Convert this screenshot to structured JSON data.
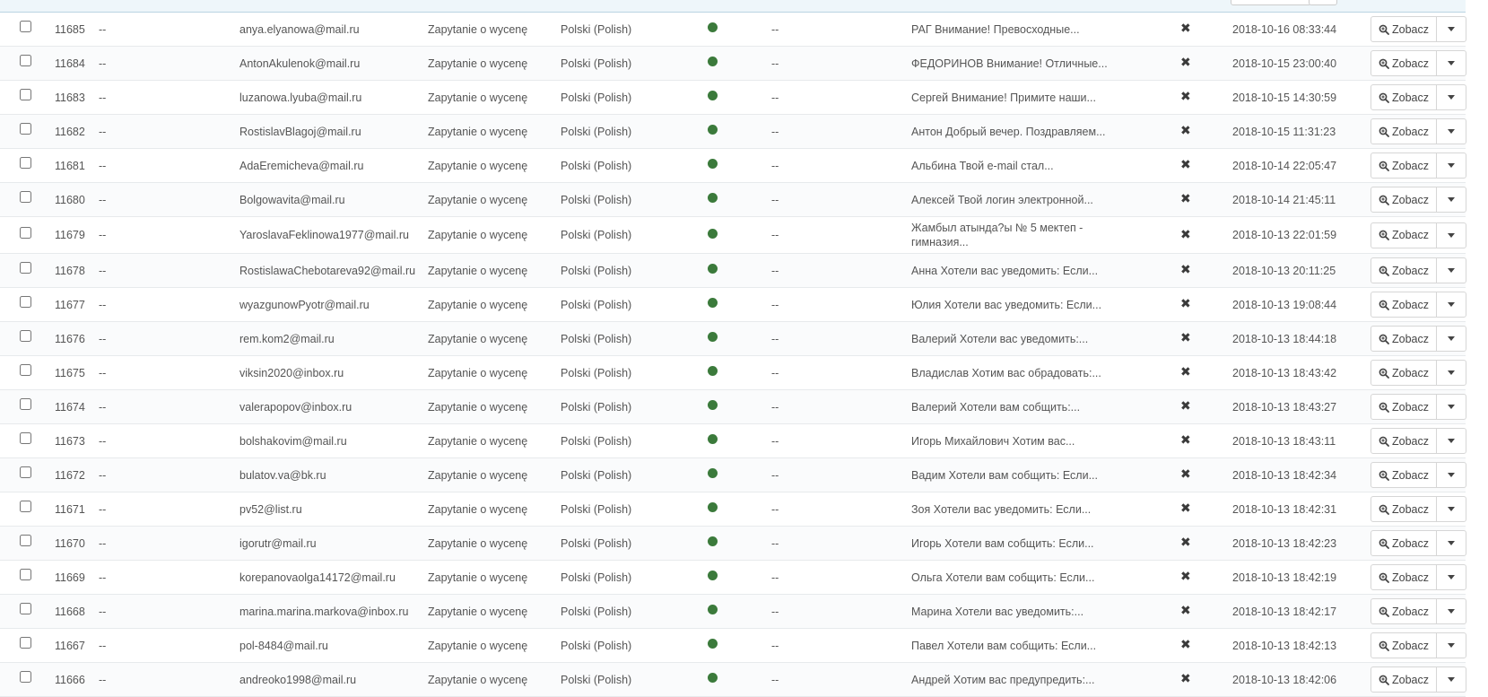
{
  "colors": {
    "status_active": "#3b7a3b",
    "header_band": "#eef6fa"
  },
  "icons": {
    "status": "filled-circle",
    "flag": "x-mark",
    "view": "magnifier-plus",
    "dropdown": "caret-down"
  },
  "view_label": "Zobacz",
  "rows": [
    {
      "id": "11685",
      "dash": "--",
      "email": "anya.elyanowa@mail.ru",
      "subject": "Zapytanie o wycenę",
      "language": "Polski (Polish)",
      "dash2": "--",
      "message": "РАГ Внимание! Превосходные...",
      "date": "2018-10-16 08:33:44"
    },
    {
      "id": "11684",
      "dash": "--",
      "email": "AntonAkulenok@mail.ru",
      "subject": "Zapytanie o wycenę",
      "language": "Polski (Polish)",
      "dash2": "--",
      "message": "ФЕДОРИНОВ Внимание! Отличные...",
      "date": "2018-10-15 23:00:40"
    },
    {
      "id": "11683",
      "dash": "--",
      "email": "luzanowa.lyuba@mail.ru",
      "subject": "Zapytanie o wycenę",
      "language": "Polski (Polish)",
      "dash2": "--",
      "message": "Сергей Внимание! Примите наши...",
      "date": "2018-10-15 14:30:59"
    },
    {
      "id": "11682",
      "dash": "--",
      "email": "RostislavBlagoj@mail.ru",
      "subject": "Zapytanie o wycenę",
      "language": "Polski (Polish)",
      "dash2": "--",
      "message": "Антон Добрый вечер. Поздравляем...",
      "date": "2018-10-15 11:31:23"
    },
    {
      "id": "11681",
      "dash": "--",
      "email": "AdaEremicheva@mail.ru",
      "subject": "Zapytanie o wycenę",
      "language": "Polski (Polish)",
      "dash2": "--",
      "message": "Альбина Твой e-mail стал...",
      "date": "2018-10-14 22:05:47"
    },
    {
      "id": "11680",
      "dash": "--",
      "email": "Bolgowavita@mail.ru",
      "subject": "Zapytanie o wycenę",
      "language": "Polski (Polish)",
      "dash2": "--",
      "message": "Алексей Твой логин электронной...",
      "date": "2018-10-14 21:45:11"
    },
    {
      "id": "11679",
      "dash": "--",
      "email": "YaroslavaFeklinowa1977@mail.ru",
      "subject": "Zapytanie o wycenę",
      "language": "Polski (Polish)",
      "dash2": "--",
      "message": "Жамбыл атында?ы № 5 мектеп - гимназия...",
      "date": "2018-10-13 22:01:59"
    },
    {
      "id": "11678",
      "dash": "--",
      "email": "RostislawaChebotareva92@mail.ru",
      "subject": "Zapytanie o wycenę",
      "language": "Polski (Polish)",
      "dash2": "--",
      "message": "Анна Хотели вас уведомить: Если...",
      "date": "2018-10-13 20:11:25"
    },
    {
      "id": "11677",
      "dash": "--",
      "email": "wyazgunowPyotr@mail.ru",
      "subject": "Zapytanie o wycenę",
      "language": "Polski (Polish)",
      "dash2": "--",
      "message": "Юлия Хотели вас уведомить: Если...",
      "date": "2018-10-13 19:08:44"
    },
    {
      "id": "11676",
      "dash": "--",
      "email": "rem.kom2@mail.ru",
      "subject": "Zapytanie o wycenę",
      "language": "Polski (Polish)",
      "dash2": "--",
      "message": "Валерий Хотели вас уведомить:...",
      "date": "2018-10-13 18:44:18"
    },
    {
      "id": "11675",
      "dash": "--",
      "email": "viksin2020@inbox.ru",
      "subject": "Zapytanie o wycenę",
      "language": "Polski (Polish)",
      "dash2": "--",
      "message": "Владислав Хотим вас обрадовать:...",
      "date": "2018-10-13 18:43:42"
    },
    {
      "id": "11674",
      "dash": "--",
      "email": "valerapopov@inbox.ru",
      "subject": "Zapytanie o wycenę",
      "language": "Polski (Polish)",
      "dash2": "--",
      "message": "Валерий Хотели вам собщить:...",
      "date": "2018-10-13 18:43:27"
    },
    {
      "id": "11673",
      "dash": "--",
      "email": "bolshakovim@mail.ru",
      "subject": "Zapytanie o wycenę",
      "language": "Polski (Polish)",
      "dash2": "--",
      "message": "Игорь Михайлович Хотим вас...",
      "date": "2018-10-13 18:43:11"
    },
    {
      "id": "11672",
      "dash": "--",
      "email": "bulatov.va@bk.ru",
      "subject": "Zapytanie o wycenę",
      "language": "Polski (Polish)",
      "dash2": "--",
      "message": "Вадим Хотели вам собщить: Если...",
      "date": "2018-10-13 18:42:34"
    },
    {
      "id": "11671",
      "dash": "--",
      "email": "pv52@list.ru",
      "subject": "Zapytanie o wycenę",
      "language": "Polski (Polish)",
      "dash2": "--",
      "message": "Зоя Хотели вас уведомить: Если...",
      "date": "2018-10-13 18:42:31"
    },
    {
      "id": "11670",
      "dash": "--",
      "email": "igorutr@mail.ru",
      "subject": "Zapytanie o wycenę",
      "language": "Polski (Polish)",
      "dash2": "--",
      "message": "Игорь Хотели вам собщить: Если...",
      "date": "2018-10-13 18:42:23"
    },
    {
      "id": "11669",
      "dash": "--",
      "email": "korepanovaolga14172@mail.ru",
      "subject": "Zapytanie o wycenę",
      "language": "Polski (Polish)",
      "dash2": "--",
      "message": "Ольга Хотели вам собщить: Если...",
      "date": "2018-10-13 18:42:19"
    },
    {
      "id": "11668",
      "dash": "--",
      "email": "marina.marina.markova@inbox.ru",
      "subject": "Zapytanie o wycenę",
      "language": "Polski (Polish)",
      "dash2": "--",
      "message": "Марина Хотели вас уведомить:...",
      "date": "2018-10-13 18:42:17"
    },
    {
      "id": "11667",
      "dash": "--",
      "email": "pol-8484@mail.ru",
      "subject": "Zapytanie o wycenę",
      "language": "Polski (Polish)",
      "dash2": "--",
      "message": "Павел Хотели вам собщить: Если...",
      "date": "2018-10-13 18:42:13"
    },
    {
      "id": "11666",
      "dash": "--",
      "email": "andreoko1998@mail.ru",
      "subject": "Zapytanie o wycenę",
      "language": "Polski (Polish)",
      "dash2": "--",
      "message": "Андрей Хотим вас предупредить:...",
      "date": "2018-10-13 18:42:06"
    }
  ]
}
